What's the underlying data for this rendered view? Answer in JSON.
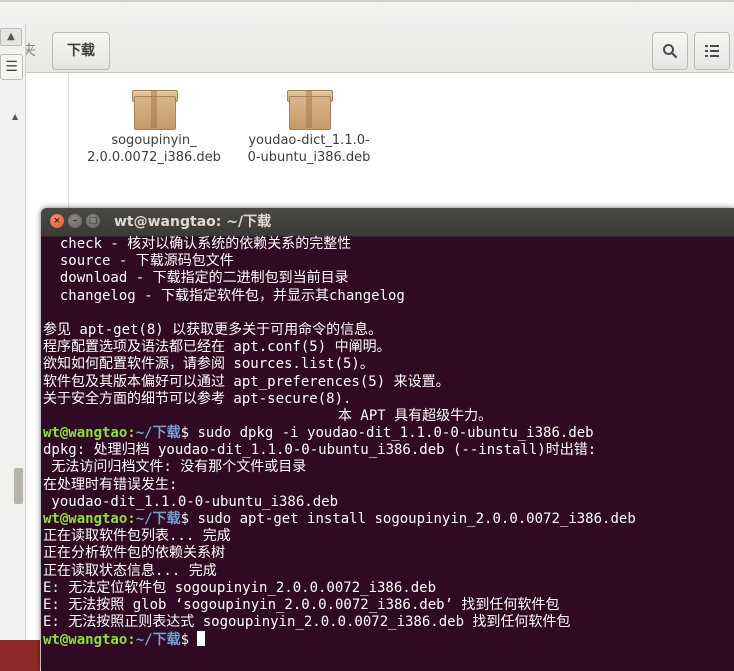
{
  "file_manager": {
    "crumb_prev": "夹",
    "crumb_current": "下载",
    "files": [
      {
        "name_line1": "sogoupinyin_",
        "name_line2": "2.0.0.0072_i386.deb",
        "icon": "deb-package-icon"
      },
      {
        "name_line1": "youdao-dict_1.1.0-",
        "name_line2": "0-ubuntu_i386.deb",
        "icon": "deb-package-icon"
      }
    ]
  },
  "terminal": {
    "title": "wt@wangtao: ~/下载",
    "prompt_user": "wt@wangtao",
    "prompt_sep": ":",
    "prompt_path": "~/下载",
    "prompt_symbol": "$",
    "lines": [
      {
        "type": "text",
        "text": "  check - 核对以确认系统的依赖关系的完整性"
      },
      {
        "type": "text",
        "text": "  source - 下载源码包文件"
      },
      {
        "type": "text",
        "text": "  download - 下载指定的二进制包到当前目录"
      },
      {
        "type": "text",
        "text": "  changelog - 下载指定软件包，并显示其changelog"
      },
      {
        "type": "text",
        "text": ""
      },
      {
        "type": "text",
        "text": "参见 apt-get(8) 以获取更多关于可用命令的信息。"
      },
      {
        "type": "text",
        "text": "程序配置选项及语法都已经在 apt.conf(5) 中阐明。"
      },
      {
        "type": "text",
        "text": "欲知如何配置软件源，请参阅 sources.list(5)。"
      },
      {
        "type": "text",
        "text": "软件包及其版本偏好可以通过 apt_preferences(5) 来设置。"
      },
      {
        "type": "text",
        "text": "关于安全方面的细节可以参考 apt-secure(8)."
      },
      {
        "type": "text",
        "text": "                                   本 APT 具有超级牛力。"
      },
      {
        "type": "prompt",
        "cmd": " sudo dpkg -i youdao-dit_1.1.0-0-ubuntu_i386.deb"
      },
      {
        "type": "text",
        "text": "dpkg: 处理归档 youdao-dit_1.1.0-0-ubuntu_i386.deb (--install)时出错:"
      },
      {
        "type": "text",
        "text": " 无法访问归档文件: 没有那个文件或目录"
      },
      {
        "type": "text",
        "text": "在处理时有错误发生:"
      },
      {
        "type": "text",
        "text": " youdao-dit_1.1.0-0-ubuntu_i386.deb"
      },
      {
        "type": "prompt",
        "cmd": " sudo apt-get install sogoupinyin_2.0.0.0072_i386.deb"
      },
      {
        "type": "text",
        "text": "正在读取软件包列表... 完成"
      },
      {
        "type": "text",
        "text": "正在分析软件包的依赖关系树"
      },
      {
        "type": "text",
        "text": "正在读取状态信息... 完成"
      },
      {
        "type": "text",
        "text": "E: 无法定位软件包 sogoupinyin_2.0.0.0072_i386.deb"
      },
      {
        "type": "text",
        "text": "E: 无法按照 glob ‘sogoupinyin_2.0.0.0072_i386.deb’ 找到任何软件包"
      },
      {
        "type": "text",
        "text": "E: 无法按照正则表达式 sogoupinyin_2.0.0.0072_i386.deb 找到任何软件包"
      },
      {
        "type": "prompt_cursor",
        "cmd": " "
      }
    ]
  }
}
